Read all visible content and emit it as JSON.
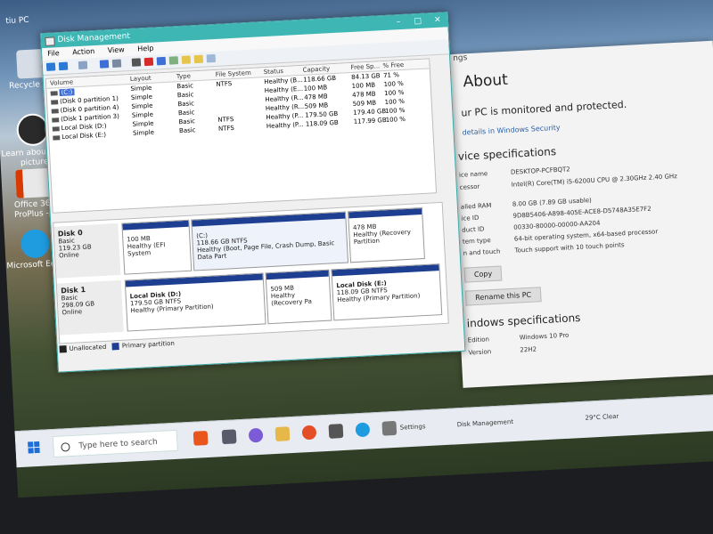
{
  "desktop": {
    "icons": [
      {
        "label": "Recycle Bin",
        "color": "#d6dde6"
      },
      {
        "label": "Learn about this picture",
        "color": "#2a2a2a"
      },
      {
        "label": "Office 365 ProPlus -...",
        "color": "#e8e8e8"
      },
      {
        "label": "Microsoft Edge",
        "color": "#1f9be0"
      }
    ],
    "top_label": "tiu PC"
  },
  "disk_management": {
    "title": "Disk Management",
    "menu": [
      "File",
      "Action",
      "View",
      "Help"
    ],
    "columns": [
      "Volume",
      "Layout",
      "Type",
      "File System",
      "Status",
      "Capacity",
      "Free Sp...",
      "% Free"
    ],
    "volumes": [
      {
        "volume": "(C:)",
        "layout": "Simple",
        "type": "Basic",
        "fs": "NTFS",
        "status": "Healthy (B...",
        "capacity": "118.66 GB",
        "free": "84.13 GB",
        "pct": "71 %"
      },
      {
        "volume": "(Disk 0 partition 1)",
        "layout": "Simple",
        "type": "Basic",
        "fs": "",
        "status": "Healthy (E...",
        "capacity": "100 MB",
        "free": "100 MB",
        "pct": "100 %"
      },
      {
        "volume": "(Disk 0 partition 4)",
        "layout": "Simple",
        "type": "Basic",
        "fs": "",
        "status": "Healthy (R...",
        "capacity": "478 MB",
        "free": "478 MB",
        "pct": "100 %"
      },
      {
        "volume": "(Disk 1 partition 3)",
        "layout": "Simple",
        "type": "Basic",
        "fs": "",
        "status": "Healthy (R...",
        "capacity": "509 MB",
        "free": "509 MB",
        "pct": "100 %"
      },
      {
        "volume": "Local Disk (D:)",
        "layout": "Simple",
        "type": "Basic",
        "fs": "NTFS",
        "status": "Healthy (P...",
        "capacity": "179.50 GB",
        "free": "179.40 GB",
        "pct": "100 %"
      },
      {
        "volume": "Local Disk (E:)",
        "layout": "Simple",
        "type": "Basic",
        "fs": "NTFS",
        "status": "Healthy (P...",
        "capacity": "118.09 GB",
        "free": "117.99 GB",
        "pct": "100 %"
      }
    ],
    "disks": [
      {
        "name": "Disk 0",
        "kind": "Basic",
        "size": "119.23 GB",
        "state": "Online",
        "partitions": [
          {
            "title": "",
            "line1": "100 MB",
            "line2": "Healthy (EFI System"
          },
          {
            "title": "(C:)",
            "line1": "118.66 GB NTFS",
            "line2": "Healthy (Boot, Page File, Crash Dump, Basic Data Part"
          },
          {
            "title": "",
            "line1": "478 MB",
            "line2": "Healthy (Recovery Partition"
          }
        ]
      },
      {
        "name": "Disk 1",
        "kind": "Basic",
        "size": "298.09 GB",
        "state": "Online",
        "partitions": [
          {
            "title": "Local Disk (D:)",
            "line1": "179.50 GB NTFS",
            "line2": "Healthy (Primary Partition)"
          },
          {
            "title": "",
            "line1": "509 MB",
            "line2": "Healthy (Recovery Pa"
          },
          {
            "title": "Local Disk (E:)",
            "line1": "118.09 GB NTFS",
            "line2": "Healthy (Primary Partition)"
          }
        ]
      }
    ],
    "legend": [
      {
        "label": "Unallocated",
        "color": "#222222"
      },
      {
        "label": "Primary partition",
        "color": "#1e3f91"
      }
    ]
  },
  "settings": {
    "title": "ngs",
    "heading": "About",
    "monitored": "ur PC is monitored and protected.",
    "security_link": "details in Windows Security",
    "device_specs_heading": "vice specifications",
    "specs": [
      {
        "k": "ice name",
        "v": "DESKTOP-PCFBQT2"
      },
      {
        "k": "cessor",
        "v": "Intel(R) Core(TM) i5-6200U CPU @ 2.30GHz 2.40 GHz"
      },
      {
        "k": "alled RAM",
        "v": "8.00 GB (7.89 GB usable)"
      },
      {
        "k": "ice ID",
        "v": "9D8B5406-A898-405E-ACE8-D5748A35E7F2"
      },
      {
        "k": "duct ID",
        "v": "00330-80000-00000-AA204"
      },
      {
        "k": "tem type",
        "v": "64-bit operating system, x64-based processor"
      },
      {
        "k": "n and touch",
        "v": "Touch support with 10 touch points"
      }
    ],
    "copy_button": "Copy",
    "rename_button": "Rename this PC",
    "windows_specs_heading": "indows specifications",
    "win_specs": [
      {
        "k": "Edition",
        "v": "Windows 10 Pro"
      },
      {
        "k": "Version",
        "v": "22H2"
      }
    ]
  },
  "taskbar": {
    "search_placeholder": "Type here to search",
    "settings_label": "Settings",
    "diskmgmt_label": "Disk Management",
    "weather": "29°C Clear"
  }
}
